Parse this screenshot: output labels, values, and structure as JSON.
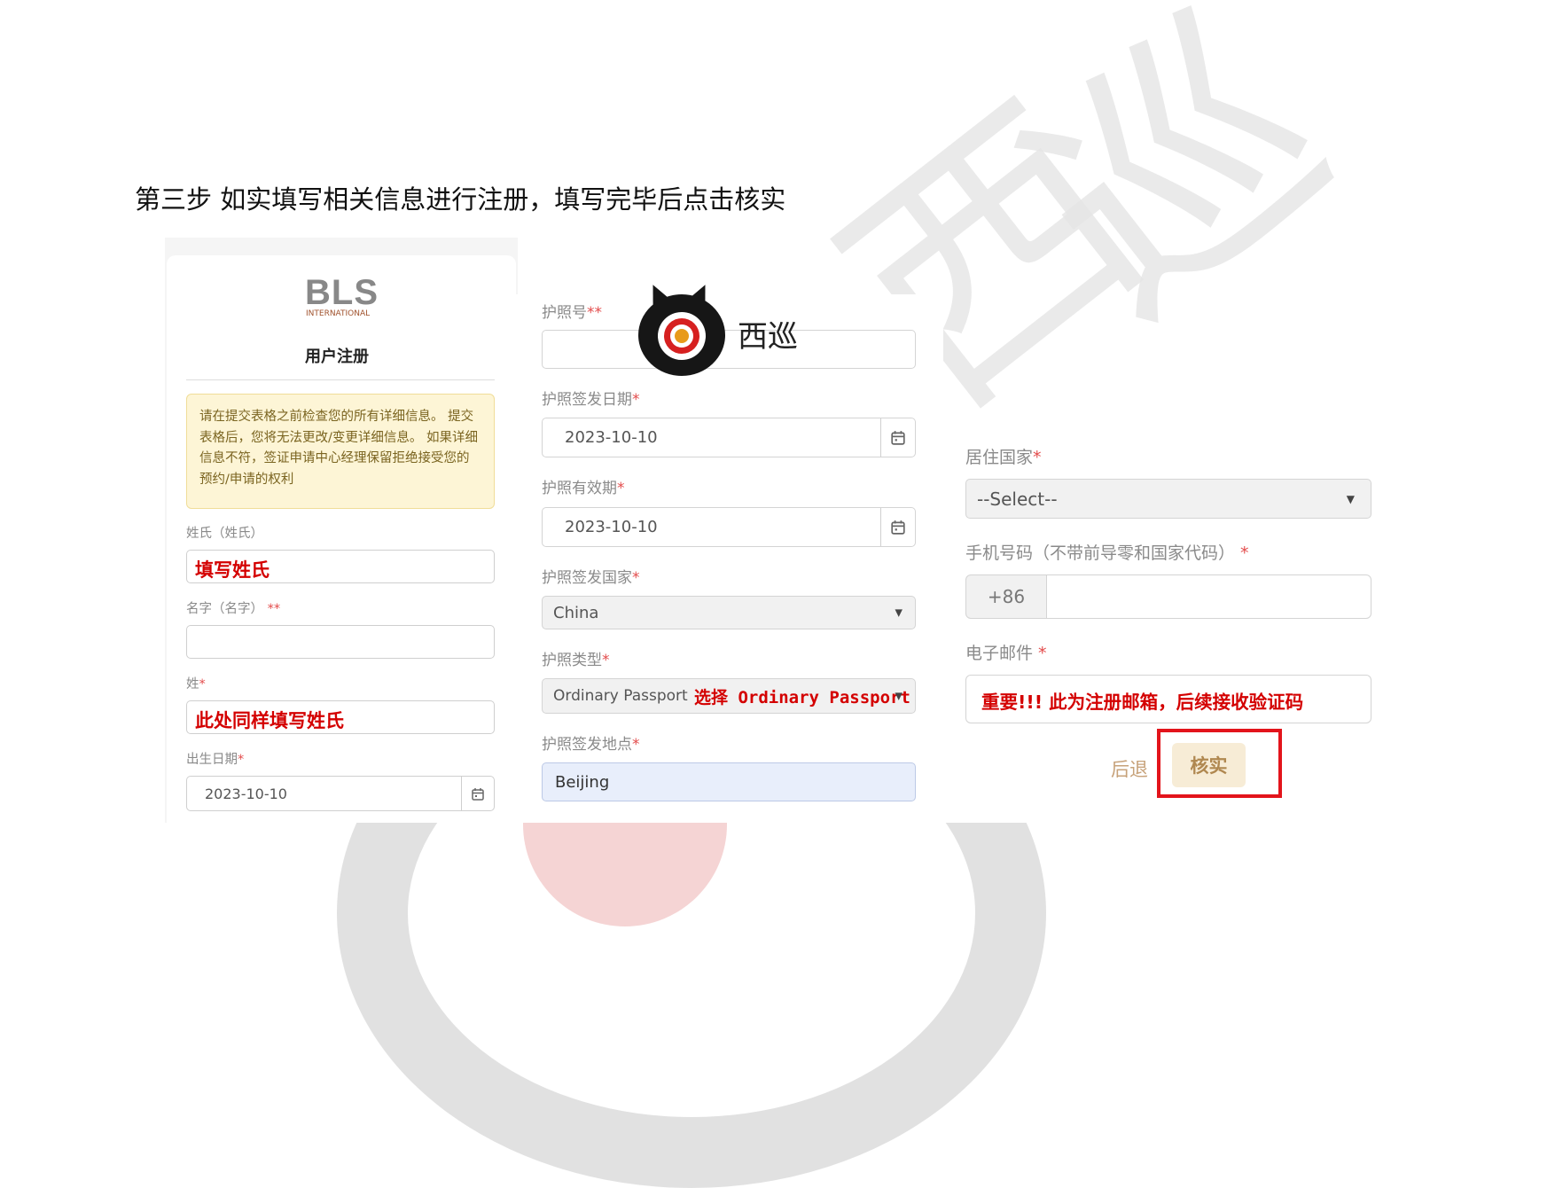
{
  "instruction": "第三步  如实填写相关信息进行注册，填写完毕后点击核实",
  "watermark": {
    "chars": [
      "西",
      "巡"
    ]
  },
  "logo": {
    "main": "BLS",
    "sub": "INTERNATIONAL"
  },
  "form": {
    "title": "用户注册",
    "alert": "请在提交表格之前检查您的所有详细信息。 提交表格后，您将无法更改/变更详细信息。 如果详细信息不符，签证申请中心经理保留拒绝接受您的预约/申请的权利",
    "surname": {
      "label": "姓氏（姓氏）",
      "annotation": "填写姓氏"
    },
    "given_name": {
      "label": "名字（名字）",
      "req": "**"
    },
    "last_name": {
      "label": "姓",
      "req": "*",
      "annotation": "此处同样填写姓氏"
    },
    "dob": {
      "label": "出生日期",
      "req": "*",
      "value": "2023-10-10"
    },
    "passport_no": {
      "label": "护照号",
      "req": "**"
    },
    "issue_date": {
      "label": "护照签发日期",
      "req": "*",
      "value": "2023-10-10"
    },
    "expiry_date": {
      "label": "护照有效期",
      "req": "*",
      "value": "2023-10-10"
    },
    "issue_country": {
      "label": "护照签发国家",
      "req": "*",
      "value": "China"
    },
    "passport_type": {
      "label": "护照类型",
      "req": "*",
      "value": "Ordinary Passport",
      "annotation": "选择 Ordinary Passport"
    },
    "issue_place": {
      "label": "护照签发地点",
      "req": "*",
      "value": "Beijing"
    },
    "residence": {
      "label": "居住国家",
      "req": "*",
      "value": "--Select--"
    },
    "mobile": {
      "label": "手机号码（不带前导零和国家代码）",
      "req": " *",
      "code": "+86"
    },
    "email": {
      "label": "电子邮件",
      "req": " *",
      "annotation": "重要!!! 此为注册邮箱，后续接收验证码"
    },
    "back_label": "后退",
    "verify_label": "核实"
  },
  "brand": {
    "name": "西巡"
  },
  "colors": {
    "annotation": "#d40000",
    "highlight": "#e3141b",
    "required": "#e34c4c"
  }
}
